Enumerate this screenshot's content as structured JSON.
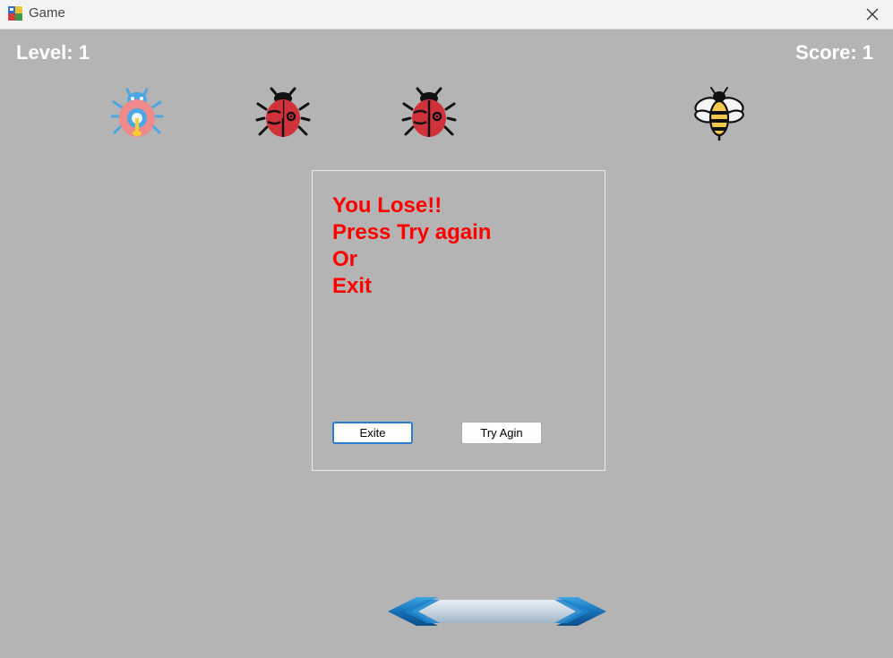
{
  "window": {
    "title": "Game"
  },
  "hud": {
    "level": "Level: 1",
    "score": "Score: 1"
  },
  "bugs": [
    {
      "icon": "blue-beetle-icon"
    },
    {
      "icon": "ladybug-icon"
    },
    {
      "icon": "ladybug-icon"
    },
    {
      "icon": "bee-icon"
    }
  ],
  "dialog": {
    "lines": [
      "You Lose!!",
      "Press Try again",
      "Or",
      "Exit"
    ],
    "exit_label": "Exite",
    "try_label": "Try Agin"
  },
  "paddle": {
    "icon": "double-arrow-paddle-icon"
  },
  "colors": {
    "background": "#b4b4b4",
    "message": "#ff0000",
    "hud_text": "#ffffff",
    "focus_border": "#2b7bd0"
  }
}
